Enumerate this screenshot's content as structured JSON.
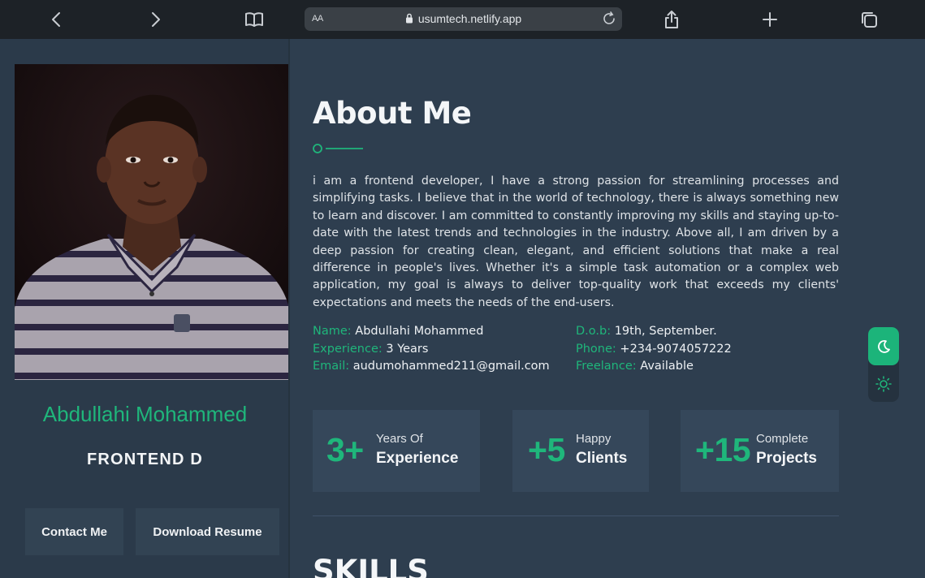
{
  "browser": {
    "text_size_label": "AA",
    "url": "usumtech.netlify.app",
    "icons": [
      "chevron-left-icon",
      "chevron-right-icon",
      "book-icon",
      "lock-icon",
      "reload-icon",
      "share-icon",
      "plus-icon",
      "tabs-icon"
    ]
  },
  "profile": {
    "name": "Abdullahi Mohammed",
    "role": "FRONTEND D",
    "contact_label": "Contact Me",
    "download_label": "Download Resume"
  },
  "about": {
    "heading": "About Me",
    "text": "i am a frontend developer, I have a strong passion for streamlining processes and simplifying tasks. I believe that in the world of technology, there is always something new to learn and discover. I am committed to constantly improving my skills and staying up-to-date with the latest trends and technologies in the industry. Above all, I am driven by a deep passion for creating clean, elegant, and efficient solutions that make a real difference in people's lives. Whether it's a simple task automation or a complex web application, my goal is always to deliver top-quality work that exceeds my clients' expectations and meets the needs of the end-users.",
    "info_left": [
      {
        "key": "Name:",
        "value": "Abdullahi Mohammed"
      },
      {
        "key": "Experience:",
        "value": "3 Years"
      },
      {
        "key": "Email:",
        "value": "audumohammed211@gmail.com"
      }
    ],
    "info_right": [
      {
        "key": "D.o.b:",
        "value": "19th, September."
      },
      {
        "key": "Phone:",
        "value": "+234-9074057222"
      },
      {
        "key": "Freelance:",
        "value": "Available"
      }
    ]
  },
  "stats": [
    {
      "number": "3+",
      "label_top": "Years Of",
      "label_bottom": "Experience"
    },
    {
      "number": "+5",
      "label_top": "Happy",
      "label_bottom": "Clients"
    },
    {
      "number": "+15",
      "label_top": "Complete",
      "label_bottom": "Projects"
    }
  ],
  "skills": {
    "heading": "SKILLS"
  },
  "theme": {
    "dark_icon": "moon-icon",
    "light_icon": "sun-icon"
  },
  "colors": {
    "accent": "#1fb67b",
    "background": "#2e3e4f",
    "card": "#35475a",
    "toolbar": "#1d2227"
  }
}
